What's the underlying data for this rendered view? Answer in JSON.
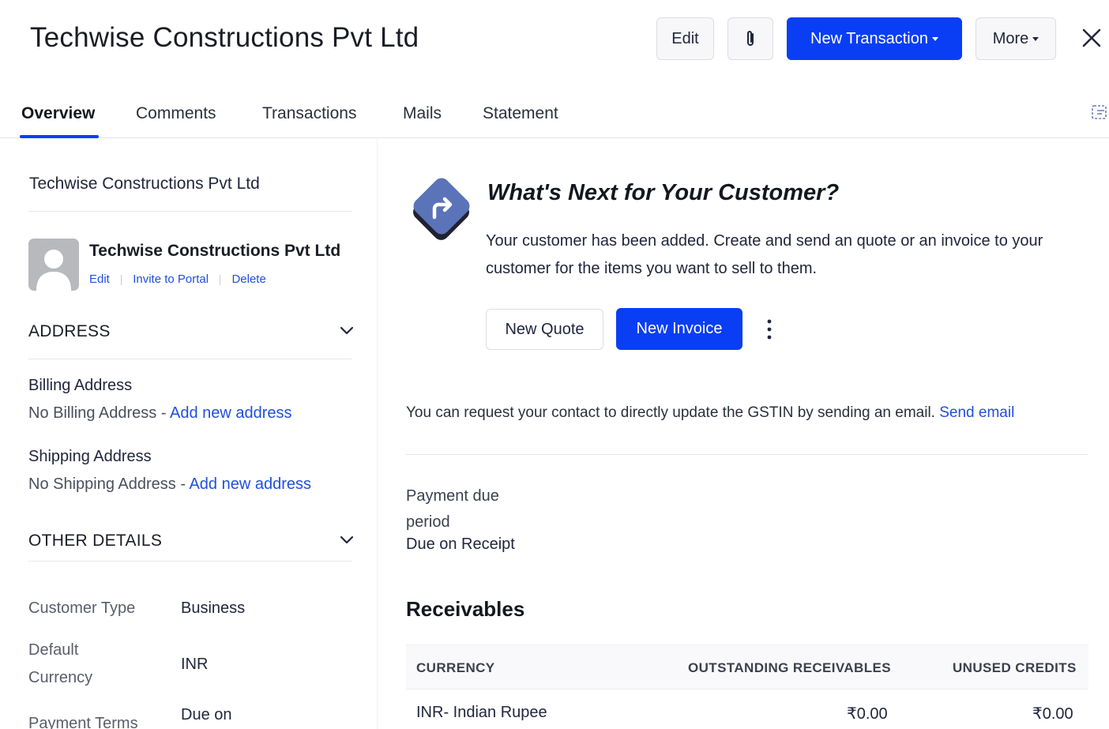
{
  "header": {
    "title": "Techwise Constructions Pvt Ltd",
    "edit_label": "Edit",
    "new_transaction_label": "New Transaction",
    "more_label": "More"
  },
  "tabs": [
    {
      "label": "Overview",
      "active": true
    },
    {
      "label": "Comments"
    },
    {
      "label": "Transactions"
    },
    {
      "label": "Mails"
    },
    {
      "label": "Statement"
    }
  ],
  "left": {
    "company": "Techwise Constructions Pvt Ltd",
    "contact": {
      "name": "Techwise Constructions Pvt Ltd",
      "links": [
        "Edit",
        "Invite to Portal",
        "Delete"
      ]
    },
    "address": {
      "title": "ADDRESS",
      "billing_label": "Billing Address",
      "billing_empty": "No Billing Address",
      "shipping_label": "Shipping Address",
      "shipping_empty": "No Shipping Address",
      "add_link": "Add new address",
      "dash": " - "
    },
    "other": {
      "title": "OTHER DETAILS",
      "customer_type_key": "Customer Type",
      "customer_type_val": "Business",
      "currency_key_1": "Default",
      "currency_key_2": "Currency",
      "currency_val": "INR",
      "payment_terms_key": "Payment Terms",
      "payment_terms_val": "Due on"
    }
  },
  "next": {
    "title": "What's Next for Your Customer?",
    "desc": "Your customer has been added. Create and send an quote or an invoice to your customer for the items you want to sell to them.",
    "new_quote": "New Quote",
    "new_invoice": "New Invoice"
  },
  "gstin": {
    "text": "You can request your contact to directly update the GSTIN by sending an email.",
    "link": "Send email"
  },
  "payment": {
    "label_1": "Payment due",
    "label_2": "period",
    "value": "Due on Receipt"
  },
  "receivables": {
    "title": "Receivables",
    "headers": [
      "CURRENCY",
      "OUTSTANDING RECEIVABLES",
      "UNUSED CREDITS"
    ],
    "rows": [
      [
        "INR- Indian Rupee",
        "₹0.00",
        "₹0.00"
      ]
    ]
  },
  "colors": {
    "primary": "#0a3ef5",
    "link": "#1f4fe0",
    "icon_tile": "#5b73b8"
  },
  "icons": [
    "paperclip-icon",
    "close-icon",
    "sidebar-toggle-icon",
    "chevron-down-icon",
    "avatar-icon",
    "arrow-turn-icon",
    "kebab-icon"
  ]
}
